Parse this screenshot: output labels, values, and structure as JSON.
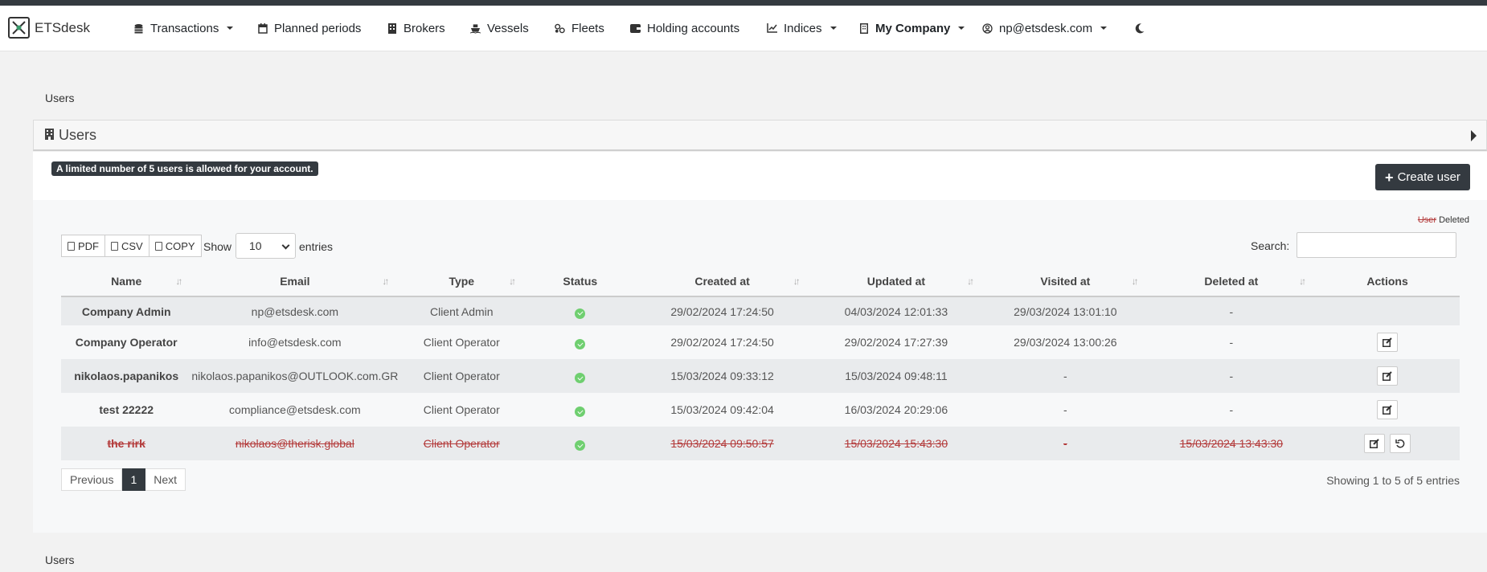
{
  "brand": {
    "name": "ETSdesk"
  },
  "nav": {
    "items": [
      {
        "label": "Transactions",
        "icon": "coins-icon",
        "dropdown": true
      },
      {
        "label": "Planned periods",
        "icon": "calendar-icon",
        "dropdown": false
      },
      {
        "label": "Brokers",
        "icon": "building-icon",
        "dropdown": false
      },
      {
        "label": "Vessels",
        "icon": "ship-icon",
        "dropdown": false
      },
      {
        "label": "Fleets",
        "icon": "fleet-icon",
        "dropdown": false
      },
      {
        "label": "Holding accounts",
        "icon": "wallet-icon",
        "dropdown": false
      },
      {
        "label": "Indices",
        "icon": "chart-line-icon",
        "dropdown": true
      },
      {
        "label": "My Company",
        "icon": "company-icon",
        "dropdown": true
      },
      {
        "label": "np@etsdesk.com",
        "icon": "user-circle-icon",
        "dropdown": true
      }
    ],
    "theme_toggle_icon": "moon-icon"
  },
  "breadcrumb": {
    "label": "Users"
  },
  "card": {
    "title": "Users",
    "limit_notice": "A limited number of 5 users is allowed for your account.",
    "create_label": "Create user",
    "legend_user": "User",
    "legend_deleted": "Deleted"
  },
  "toolbar": {
    "pdf": "PDF",
    "csv": "CSV",
    "copy": "COPY",
    "show": "Show",
    "entries_value": "10",
    "entries": "entries",
    "search_label": "Search:"
  },
  "table": {
    "headers": [
      "Name",
      "Email",
      "Type",
      "Status",
      "Created at",
      "Updated at",
      "Visited at",
      "Deleted at",
      "Actions"
    ],
    "rows": [
      {
        "name": "Company Admin",
        "email": "np@etsdesk.com",
        "type": "Client Admin",
        "created": "29/02/2024 17:24:50",
        "updated": "04/03/2024 12:01:33",
        "visited": "29/03/2024 13:01:10",
        "deleted": "-"
      },
      {
        "name": "Company Operator",
        "email": "info@etsdesk.com",
        "type": "Client Operator",
        "created": "29/02/2024 17:24:50",
        "updated": "29/02/2024 17:27:39",
        "visited": "29/03/2024 13:00:26",
        "deleted": "-"
      },
      {
        "name": "nikolaos.papanikos",
        "email": "nikolaos.papanikos@OUTLOOK.com.GR",
        "type": "Client Operator",
        "created": "15/03/2024 09:33:12",
        "updated": "15/03/2024 09:48:11",
        "visited": "-",
        "deleted": "-"
      },
      {
        "name": "test 22222",
        "email": "compliance@etsdesk.com",
        "type": "Client Operator",
        "created": "15/03/2024 09:42:04",
        "updated": "16/03/2024 20:29:06",
        "visited": "-",
        "deleted": "-"
      },
      {
        "name": "the rirk",
        "email": "nikolaos@therisk.global",
        "type": "Client Operator",
        "created": "15/03/2024 09:50:57",
        "updated": "15/03/2024 15:43:30",
        "visited": "-",
        "deleted": "15/03/2024 13:43:30"
      }
    ]
  },
  "pagination": {
    "previous": "Previous",
    "current": "1",
    "next": "Next",
    "info": "Showing 1 to 5 of 5 entries"
  },
  "footer_breadcrumb": "Users",
  "colors": {
    "dark": "#343a40",
    "status_active": "#6fcf70",
    "deleted": "#b33a3a"
  }
}
